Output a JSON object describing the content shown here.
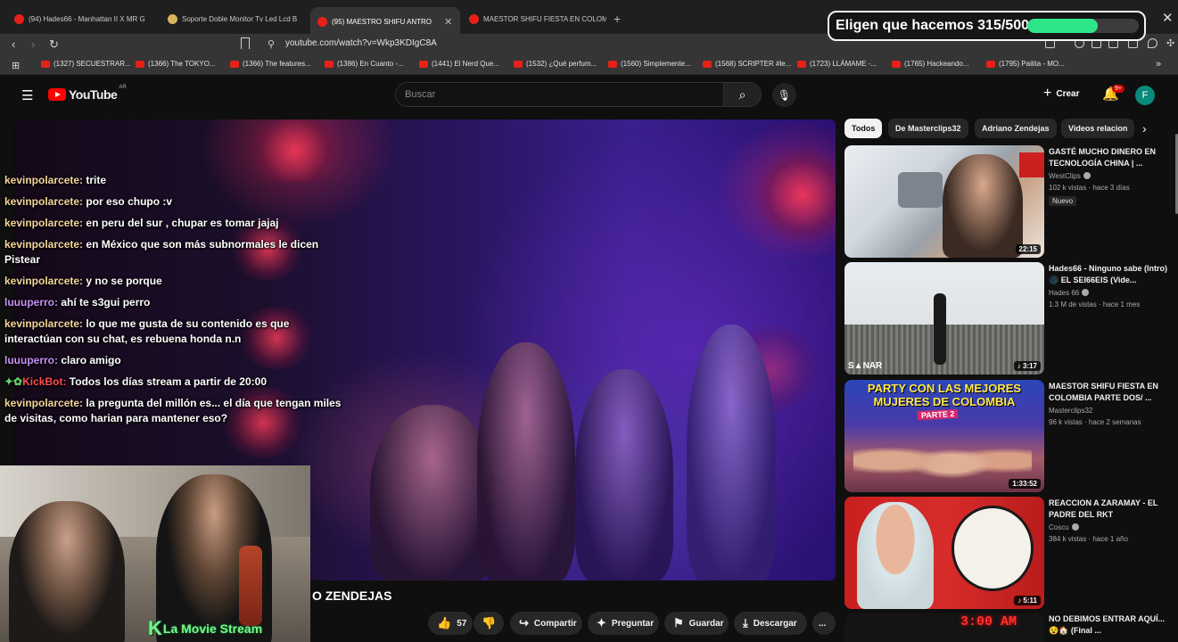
{
  "browser": {
    "tabs": [
      {
        "label": "(94) Hades66 - Manhattan II X MR G",
        "active": false
      },
      {
        "label": "Soporte Doble Monitor Tv Led Lcd B",
        "active": false
      },
      {
        "label": "(95) MAESTRO SHIFU ANTRO",
        "active": true
      },
      {
        "label": "MAESTOR SHIFU FIESTA EN COLOMB",
        "active": false
      }
    ],
    "new_tab": "+",
    "url": "youtube.com/watch?v=Wkp3KDIgC8A",
    "bookmarks": [
      "(1327) SECUESTRAR...",
      "(1366) The TOKYO...",
      "(1366) The features...",
      "(1386) En Cuanto -...",
      "(1441) El Nerd Que...",
      "(1532) ¿Qué perfum...",
      "(1560) Simplemente...",
      "(1568) SCRIPTER #le...",
      "(1723) LLÁMAME -...",
      "(1765) Hackeando...",
      "(1795) Pailita - MO..."
    ]
  },
  "goal": {
    "text": "Eligen que hacemos 315/500",
    "progress": 0.63
  },
  "youtube": {
    "logo": "YouTube",
    "region": "AR",
    "search_placeholder": "Buscar",
    "create": "Crear",
    "notifications": "9+",
    "avatar_letter": "F"
  },
  "chat": [
    {
      "user": "kevinpolarcete:",
      "text": "trite",
      "color": "gold"
    },
    {
      "user": "kevinpolarcete:",
      "text": "por eso chupo :v",
      "color": "gold"
    },
    {
      "user": "kevinpolarcete:",
      "text": "en peru del sur , chupar es tomar jajaj",
      "color": "gold"
    },
    {
      "user": "kevinpolarcete:",
      "text": "en México que son más subnormales le dicen Pistear",
      "color": "gold"
    },
    {
      "user": "kevinpolarcete:",
      "text": "y no se porque",
      "color": "gold"
    },
    {
      "user": "luuuperro:",
      "text": "ahí te s3gui perro",
      "color": "purple"
    },
    {
      "user": "kevinpolarcete:",
      "text": "lo que me gusta de su contenido es que interactúan con su chat, es rebuena honda n.n",
      "color": "gold"
    },
    {
      "user": "luuuperro:",
      "text": "claro amigo",
      "color": "purple"
    },
    {
      "user": "KickBot:",
      "text": "Todos los días stream a partir de 20:00",
      "color": "kick"
    },
    {
      "user": "kevinpolarcete:",
      "text": "la pregunta del millón es... el día que tengan miles de visitas, como harian para mantener eso?",
      "color": "gold"
    }
  ],
  "webcam": {
    "label": "La Movie Stream",
    "label_initial": "K"
  },
  "video": {
    "title_visible": "O ZENDEJAS"
  },
  "actions": {
    "likes": "57",
    "share": "Compartir",
    "ask": "Preguntar",
    "save": "Guardar",
    "download": "Descargar",
    "more": "..."
  },
  "chips": [
    "Todos",
    "De Masterclips32",
    "Adriano Zendejas",
    "Videos relacion"
  ],
  "recommendations": [
    {
      "title": "GASTÉ MUCHO DINERO EN TECNOLOGÍA CHINA | ...",
      "channel": "WestClips",
      "meta": "102 k vistas · hace 3 días",
      "badge": "Nuevo",
      "duration": "22:15"
    },
    {
      "title": "Hades66 - Ninguno sabe (Intro) 🌑 EL SEI66EIS (Vide...",
      "channel": "Hades 66",
      "meta": "1.3 M de vistas · hace 1 mes",
      "badge": "",
      "duration": "3:17"
    },
    {
      "title": "MAESTOR SHIFU FIESTA EN COLOMBIA PARTE DOS/ ...",
      "channel": "Masterclips32",
      "meta": "96 k vistas · hace 2 semanas",
      "badge": "",
      "duration": "1:33:52"
    },
    {
      "title": "REACCION A ZARAMAY - EL PADRE DEL RKT",
      "channel": "Coscu",
      "meta": "384 k vistas · hace 1 año",
      "badge": "",
      "duration": "5:11"
    },
    {
      "title": "NO DEBIMOS ENTRAR AQUÍ... 😵🏠 (Final ...",
      "channel": "",
      "meta": "",
      "badge": "",
      "duration": ""
    }
  ],
  "thumb_text": {
    "sonar": "S▲NAR",
    "party_line1": "PARTY CON LAS MEJORES",
    "party_line2": "MUJERES DE COLOMBIA",
    "party_line3": "PARTE 2",
    "last_thumb_time": "3:00 AM"
  },
  "colors": {
    "accent_red": "#ff0000",
    "goal_fill": "#2ee68a",
    "chat_user": "#f3d69a",
    "chat_purple": "#c592f5",
    "webcam_label": "#7ff08a"
  }
}
